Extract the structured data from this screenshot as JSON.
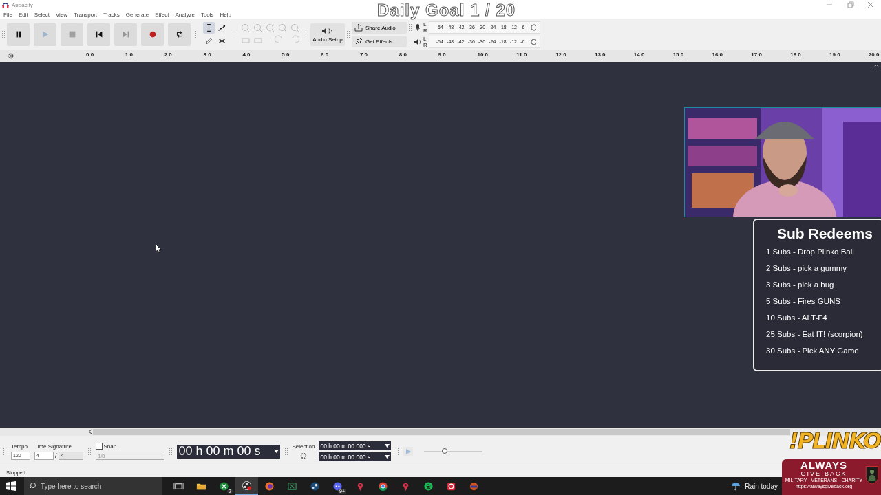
{
  "window": {
    "title": "Audacity"
  },
  "overlay_title": "Daily Goal 1 / 20",
  "menu": [
    "File",
    "Edit",
    "Select",
    "View",
    "Transport",
    "Tracks",
    "Generate",
    "Effect",
    "Analyze",
    "Tools",
    "Help"
  ],
  "transport": [
    {
      "kind": "pause",
      "disabled": false
    },
    {
      "kind": "play",
      "disabled": true
    },
    {
      "kind": "stop",
      "disabled": true
    },
    {
      "kind": "skip_start",
      "disabled": false
    },
    {
      "kind": "skip_end",
      "disabled": true
    },
    {
      "kind": "record",
      "disabled": false
    },
    {
      "kind": "loop",
      "disabled": false
    }
  ],
  "tools": [
    {
      "kind": "select",
      "selected": true
    },
    {
      "kind": "envelope",
      "selected": false
    },
    {
      "kind": "draw",
      "selected": false
    },
    {
      "kind": "multi",
      "selected": false
    }
  ],
  "audio_setup": "Audio Setup",
  "share_audio": "Share Audio",
  "get_effects": "Get Effects",
  "meters": [
    {
      "kind": "record",
      "channels": [
        "L",
        "R"
      ],
      "scale": [
        "-54",
        "-48",
        "-42",
        "-36",
        "-30",
        "-24",
        "-18",
        "-12",
        "-6"
      ]
    },
    {
      "kind": "playback",
      "channels": [
        "L",
        "R"
      ],
      "scale": [
        "-54",
        "-48",
        "-42",
        "-36",
        "-30",
        "-24",
        "-18",
        "-12",
        "-6"
      ]
    }
  ],
  "ruler": [
    "0.0",
    "1.0",
    "2.0",
    "3.0",
    "4.0",
    "5.0",
    "6.0",
    "7.0",
    "8.0",
    "9.0",
    "10.0",
    "11.0",
    "12.0",
    "13.0",
    "14.0",
    "15.0",
    "16.0",
    "17.0",
    "18.0",
    "19.0",
    "20.0"
  ],
  "sub_redeems": {
    "title": "Sub Redeems",
    "items": [
      "1 Subs - Drop Plinko Ball",
      "2 Subs - pick a gummy",
      "3 Subs - pick a bug",
      "5 Subs - Fires GUNS",
      "10 Subs - ALT-F4",
      "25 Subs - Eat IT! (scorpion)",
      "30 Subs - Pick ANY Game"
    ]
  },
  "tempo": {
    "label": "Tempo",
    "value": "120"
  },
  "time_signature": {
    "label": "Time Signature",
    "upper": "4",
    "separator": "/",
    "lower": "4"
  },
  "snap": {
    "label": "Snap",
    "checked": false,
    "value": "1/8"
  },
  "time": "00 h 00 m 00 s",
  "selection": {
    "label": "Selection",
    "start": "00 h 00 m 00.000 s",
    "end": "00 h 00 m 00.000 s"
  },
  "play_speed": {
    "level": 0.35
  },
  "status": "Stopped.",
  "taskbar": {
    "search_placeholder": "Type here to search",
    "weather": "Rain today",
    "apps": [
      {
        "kind": "taskview",
        "selected": false
      },
      {
        "kind": "folder",
        "selected": false
      },
      {
        "kind": "xbox",
        "selected": false,
        "badge": "2"
      },
      {
        "kind": "obs",
        "selected": true
      },
      {
        "kind": "firefox",
        "selected": false
      },
      {
        "kind": "excel",
        "selected": false
      },
      {
        "kind": "steam",
        "selected": false
      },
      {
        "kind": "discord",
        "selected": false,
        "badge": "9+"
      },
      {
        "kind": "pin",
        "selected": false
      },
      {
        "kind": "chrome",
        "selected": false
      },
      {
        "kind": "pin",
        "selected": false
      },
      {
        "kind": "spotify",
        "selected": false
      },
      {
        "kind": "ring",
        "selected": false
      },
      {
        "kind": "game",
        "selected": false
      }
    ]
  },
  "plinko": "!PLINKO",
  "charity": {
    "title": "ALWAYS",
    "subtitle": "GIVE-BACK",
    "tagline": "MILITARY - VETERANS - CHARITY",
    "url": "https://alwaysgiveback.org"
  }
}
